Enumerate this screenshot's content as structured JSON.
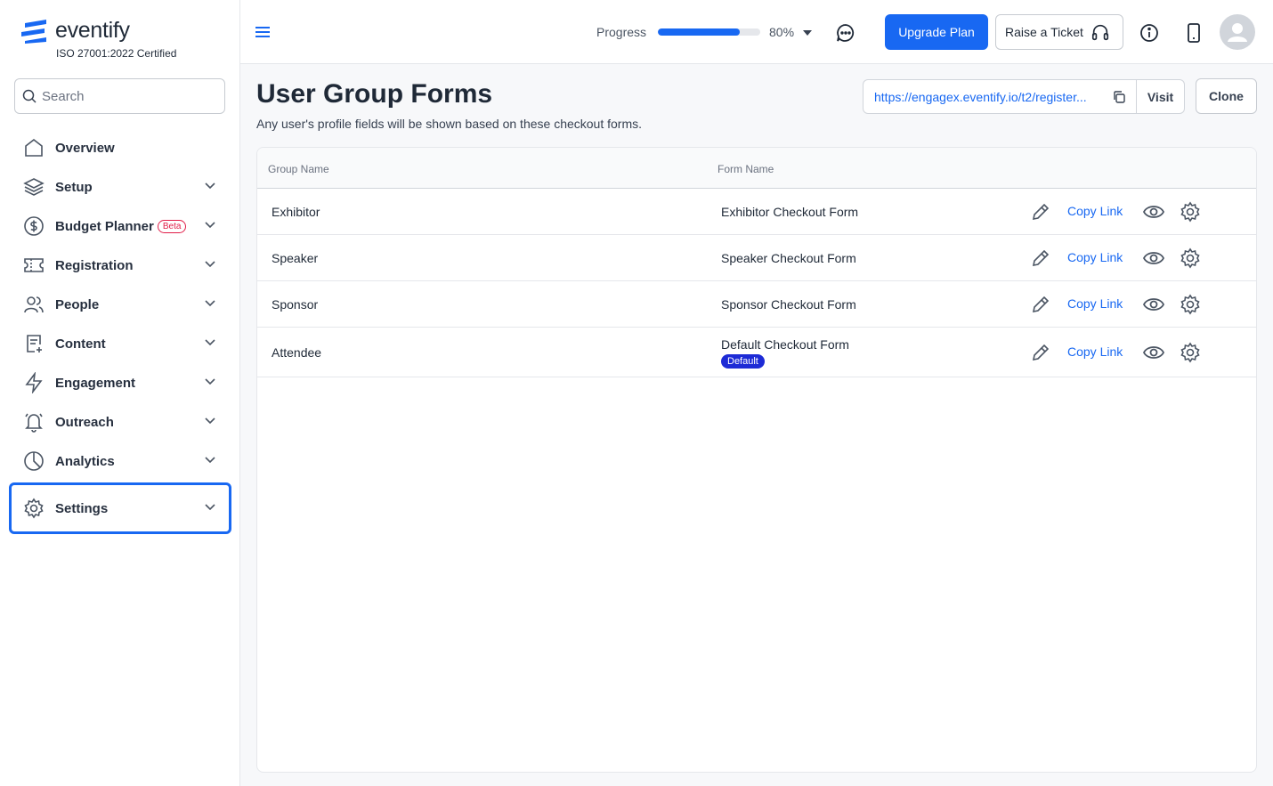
{
  "brand": {
    "name": "eventify",
    "certification": "ISO 27001:2022 Certified"
  },
  "search": {
    "placeholder": "Search"
  },
  "sidebar": {
    "items": [
      {
        "label": "Overview"
      },
      {
        "label": "Setup"
      },
      {
        "label": "Budget Planner",
        "badge": "Beta"
      },
      {
        "label": "Registration"
      },
      {
        "label": "People"
      },
      {
        "label": "Content"
      },
      {
        "label": "Engagement"
      },
      {
        "label": "Outreach"
      },
      {
        "label": "Analytics"
      },
      {
        "label": "Settings",
        "active": true
      }
    ]
  },
  "topbar": {
    "progress_label": "Progress",
    "progress_value": 80,
    "progress_text": "80%",
    "upgrade_label": "Upgrade Plan",
    "ticket_label": "Raise a Ticket"
  },
  "page": {
    "title": "User Group Forms",
    "subtitle": "Any user's profile fields will be shown based on these checkout forms.",
    "url": "https://engagex.eventify.io/t2/register...",
    "visit_label": "Visit",
    "clone_label": "Clone"
  },
  "table": {
    "columns": [
      "Group Name",
      "Form Name"
    ],
    "copy_label": "Copy Link",
    "rows": [
      {
        "group": "Exhibitor",
        "form": "Exhibitor Checkout Form"
      },
      {
        "group": "Speaker",
        "form": "Speaker Checkout Form"
      },
      {
        "group": "Sponsor",
        "form": "Sponsor Checkout Form"
      },
      {
        "group": "Attendee",
        "form": "Default Checkout Form",
        "badge": "Default"
      }
    ]
  },
  "colors": {
    "accent": "#1868f2",
    "badge": "#1d2bd6",
    "beta": "#e11d48"
  }
}
